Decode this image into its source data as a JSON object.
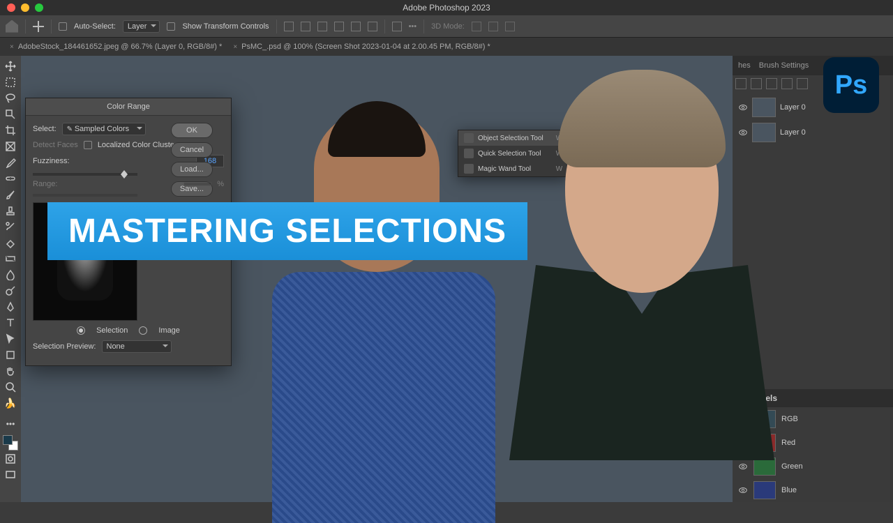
{
  "app": {
    "title": "Adobe Photoshop 2023"
  },
  "optbar": {
    "auto_select": "Auto-Select:",
    "layer": "Layer",
    "show_transform": "Show Transform Controls",
    "mode_3d": "3D Mode:"
  },
  "tabs": [
    {
      "label": "AdobeStock_184461652.jpeg @ 66.7% (Layer 0, RGB/8#) *",
      "active": true
    },
    {
      "label": "PsMC_.psd @ 100% (Screen Shot 2023-01-04 at 2.00.45 PM, RGB/8#) *",
      "active": false
    }
  ],
  "dialog": {
    "title": "Color Range",
    "select_label": "Select:",
    "select_value": "Sampled Colors",
    "detect_faces": "Detect Faces",
    "localized": "Localized Color Clusters",
    "fuzziness_label": "Fuzziness:",
    "fuzziness_value": "168",
    "range_label": "Range:",
    "range_unit": "%",
    "radio_selection": "Selection",
    "radio_image": "Image",
    "preview_label": "Selection Preview:",
    "preview_value": "None",
    "btn_ok": "OK",
    "btn_cancel": "Cancel",
    "btn_load": "Load...",
    "btn_save": "Save..."
  },
  "flyout": {
    "items": [
      {
        "label": "Object Selection Tool",
        "key": "W"
      },
      {
        "label": "Quick Selection Tool",
        "key": "W"
      },
      {
        "label": "Magic Wand Tool",
        "key": "W"
      }
    ]
  },
  "right": {
    "tab1": "hes",
    "tab2": "Brush Settings",
    "layers": [
      {
        "name": "Layer 0"
      },
      {
        "name": "Layer 0"
      }
    ],
    "channels_title": "Channels",
    "channels": [
      {
        "name": "RGB",
        "color": "#334a55"
      },
      {
        "name": "Red",
        "color": "#8a2a2a"
      },
      {
        "name": "Green",
        "color": "#2a6a3a"
      },
      {
        "name": "Blue",
        "color": "#2a3a7a"
      }
    ]
  },
  "banner": "MASTERING SELECTIONS",
  "logo": "Ps"
}
